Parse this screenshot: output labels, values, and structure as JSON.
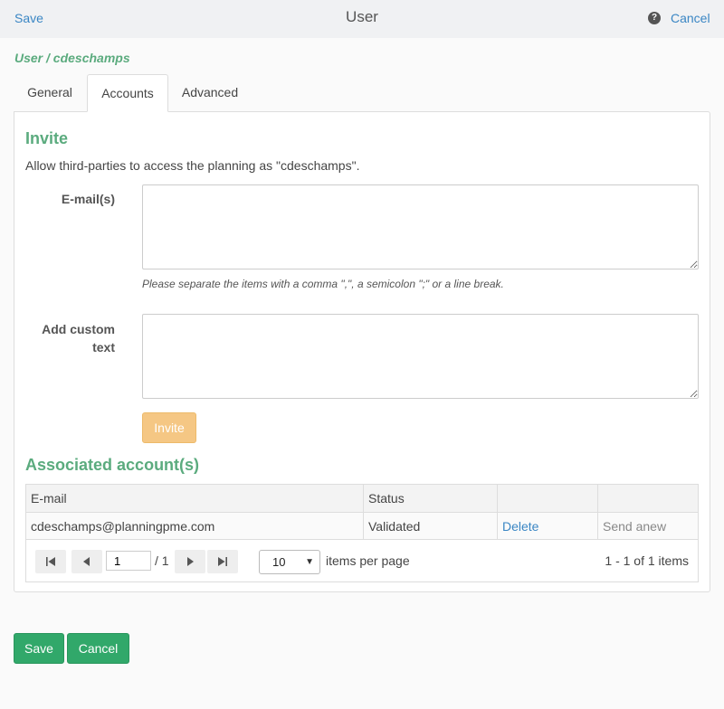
{
  "header": {
    "save_label": "Save",
    "title": "User",
    "help_glyph": "?",
    "cancel_label": "Cancel"
  },
  "breadcrumb": "User / cdeschamps",
  "tabs": [
    {
      "label": "General",
      "active": false
    },
    {
      "label": "Accounts",
      "active": true
    },
    {
      "label": "Advanced",
      "active": false
    }
  ],
  "invite": {
    "heading": "Invite",
    "description": "Allow third-parties to access the planning as \"cdeschamps\".",
    "email_label": "E-mail(s)",
    "email_value": "",
    "hint": "Please separate the items with a comma \",\", a semicolon \";\" or a line break.",
    "custom_text_label_1": "Add custom",
    "custom_text_label_2": "text",
    "custom_text_value": "",
    "invite_button": "Invite",
    "invite_button_color": "#f5c784"
  },
  "associated": {
    "heading": "Associated account(s)",
    "columns": [
      "E-mail",
      "Status",
      "",
      ""
    ],
    "rows": [
      {
        "email": "cdeschamps@planningpme.com",
        "status": "Validated",
        "delete_label": "Delete",
        "send_label": "Send anew"
      }
    ],
    "pager": {
      "first_icon": "first-page-icon",
      "prev_icon": "prev-page-icon",
      "next_icon": "next-page-icon",
      "last_icon": "last-page-icon",
      "current_page": "1",
      "total_pages": "/ 1",
      "page_size": "10",
      "items_per_page_label": "items per page",
      "info": "1 - 1 of 1 items"
    }
  },
  "footer": {
    "save_label": "Save",
    "cancel_label": "Cancel",
    "button_color": "#31a86a"
  },
  "colors": {
    "accent_green": "#5bab7e",
    "link_blue": "#3a86c4"
  }
}
